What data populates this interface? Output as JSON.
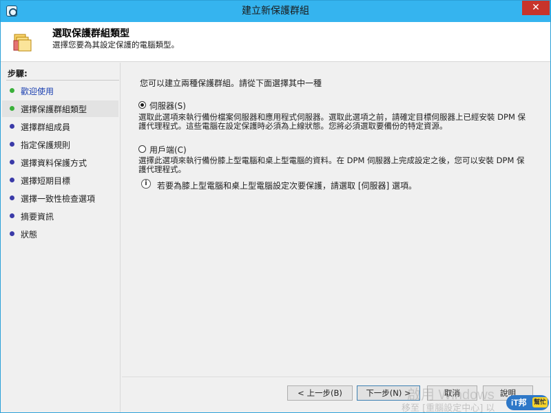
{
  "window": {
    "title": "建立新保護群組",
    "close_label": "✕"
  },
  "header": {
    "title": "選取保護群組類型",
    "subtitle": "選擇您要為其設定保護的電腦類型。"
  },
  "sidebar": {
    "steps_label": "步驟:",
    "items": [
      {
        "label": "歡迎使用",
        "status": "done"
      },
      {
        "label": "選擇保護群組類型",
        "status": "current"
      },
      {
        "label": "選擇群組成員",
        "status": "pending"
      },
      {
        "label": "指定保護規則",
        "status": "pending"
      },
      {
        "label": "選擇資料保護方式",
        "status": "pending"
      },
      {
        "label": "選擇短期目標",
        "status": "pending"
      },
      {
        "label": "選擇一致性檢查選項",
        "status": "pending"
      },
      {
        "label": "摘要資訊",
        "status": "pending"
      },
      {
        "label": "狀態",
        "status": "pending"
      }
    ]
  },
  "main": {
    "intro": "您可以建立兩種保護群組。請從下面選擇其中一種",
    "options": [
      {
        "label": "伺服器(S)",
        "selected": true,
        "description_line1": "選取此選項來執行備份檔案伺服器和應用程式伺服器。選取此選項之前，請確定目標伺服器上已經安裝 DPM 保",
        "description_line2": "護代理程式。這些電腦在設定保護時必須為上線狀態。您將必須選取要備份的特定資源。"
      },
      {
        "label": "用戶端(C)",
        "selected": false,
        "description_line1": "選擇此選項來執行備份膝上型電腦和桌上型電腦的資料。在 DPM 伺服器上完成設定之後，您可以安裝 DPM 保",
        "description_line2": "護代理程式。"
      }
    ],
    "info_text": "若要為膝上型電腦和桌上型電腦設定次要保護，請選取 [伺服器] 選項。",
    "info_icon": "i"
  },
  "footer": {
    "back_label": "< 上一步(B)",
    "next_label": "下一步(N) >",
    "cancel_label": "取消",
    "help_label": "說明"
  },
  "watermark": {
    "line1": "啟用 Windows",
    "line2": "移至 [重腦設定中心] 以",
    "logo_text": "iT邦",
    "logo_tag": "幫忙"
  },
  "colors": {
    "titlebar": "#35b4ef",
    "step_done": "#3ab03a",
    "step_pending": "#3a3aa8",
    "close_button": "#c7342b"
  }
}
